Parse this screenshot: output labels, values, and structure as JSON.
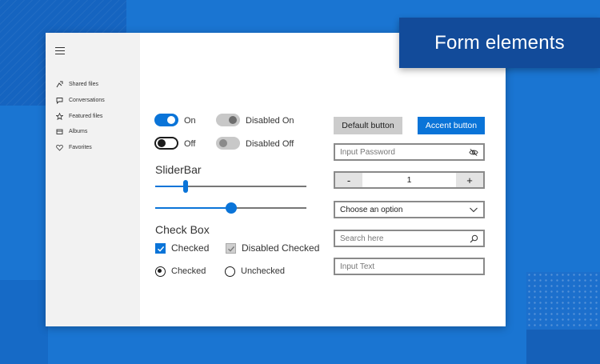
{
  "title_badge": "Form elements",
  "sidebar": {
    "items": [
      {
        "label": "Shared files",
        "icon": "shared-files-icon"
      },
      {
        "label": "Conversations",
        "icon": "chat-icon"
      },
      {
        "label": "Featured files",
        "icon": "star-icon"
      },
      {
        "label": "Albums",
        "icon": "album-icon"
      },
      {
        "label": "Favorites",
        "icon": "heart-icon"
      }
    ]
  },
  "toggles": {
    "on_label": "On",
    "off_label": "Off",
    "disabled_on_label": "Disabled On",
    "disabled_off_label": "Disabled Off"
  },
  "sliderbar": {
    "heading": "SliderBar",
    "slider1_value_fraction": 0.2,
    "slider2_value_fraction": 0.5
  },
  "checkbox": {
    "heading": "Check Box",
    "checked_label": "Checked",
    "disabled_checked_label": "Disabled Checked",
    "radio_checked_label": "Checked",
    "radio_unchecked_label": "Unchecked"
  },
  "buttons": {
    "default_label": "Default button",
    "accent_label": "Accent button"
  },
  "fields": {
    "password_placeholder": "Input Password",
    "search_placeholder": "Search here",
    "text_placeholder": "Input Text"
  },
  "stepper": {
    "minus": "-",
    "value": "1",
    "plus": "+"
  },
  "select": {
    "value": "Choose an option"
  },
  "colors": {
    "accent": "#0a74d8",
    "background": "#1a75d2",
    "badge": "#124b9a"
  }
}
